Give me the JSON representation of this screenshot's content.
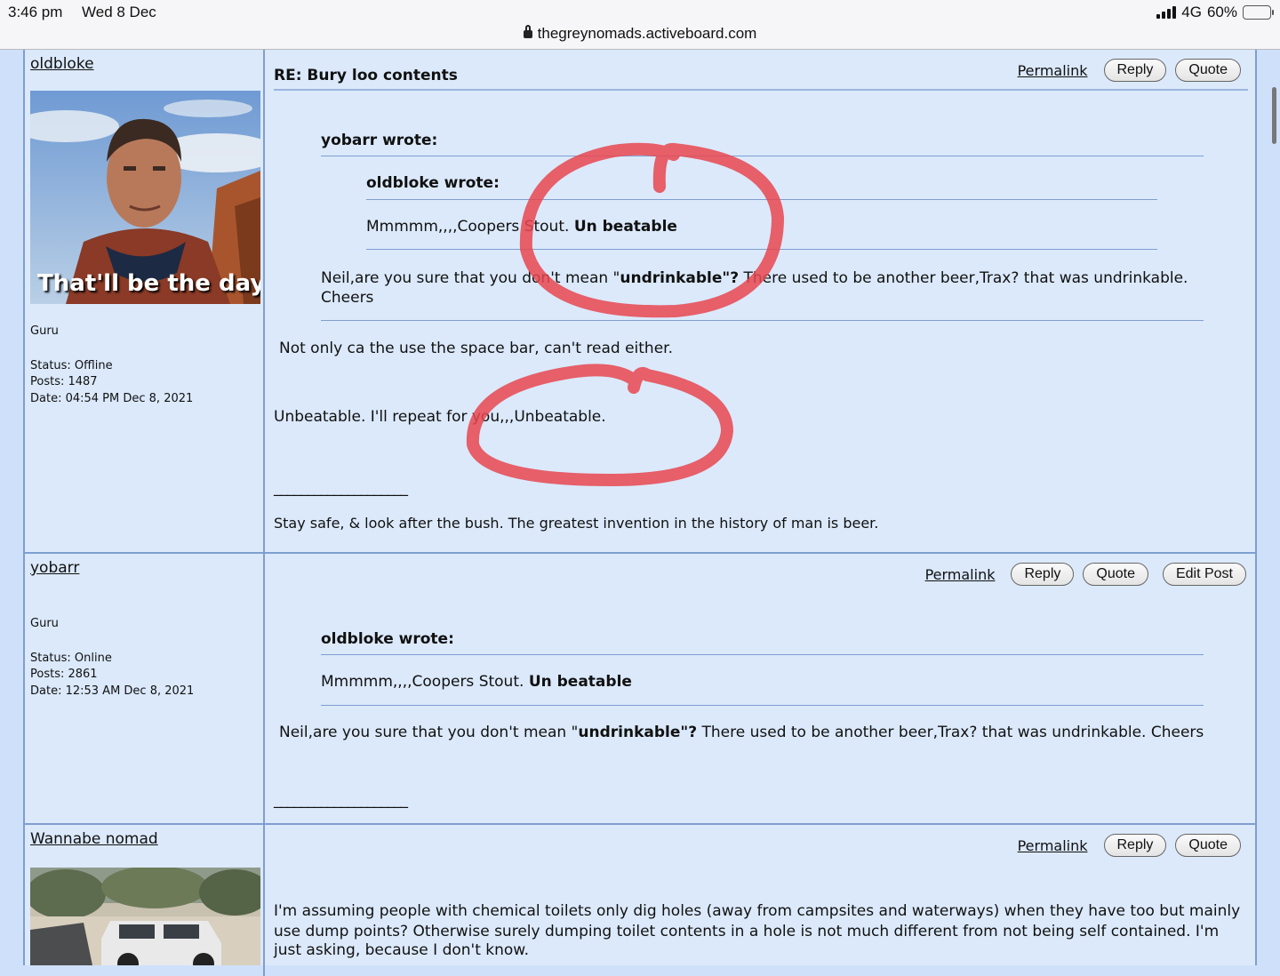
{
  "status_bar": {
    "time": "3:46 pm",
    "date": "Wed 8 Dec",
    "network": "4G",
    "battery": "60%",
    "battery_level": 0.6,
    "url": "thegreynomads.activeboard.com"
  },
  "buttons": {
    "permalink": "Permalink",
    "reply": "Reply",
    "quote": "Quote",
    "edit": "Edit Post"
  },
  "posts": [
    {
      "author": "oldbloke",
      "avatar_caption": "That'll be the day",
      "rank": "Guru",
      "status": "Status: Offline",
      "posts": "Posts: 1487",
      "date": "Date: 04:54 PM Dec 8, 2021",
      "title": "RE: Bury loo contents",
      "outer_quote_author": "yobarr wrote:",
      "inner_quote_author": "oldbloke wrote:",
      "inner_quote_text": "Mmmmm,,,,Coopers Stout. ",
      "inner_quote_bold": "Un beatable",
      "outer_quote_text_a": " Neil,are you sure that you don't  mean \"",
      "outer_quote_bold": "undrinkable\"?",
      "outer_quote_text_b": "  There used to be another beer,Trax? that was undrinkable.",
      "outer_quote_text_c": "Cheers",
      "reply_1": "Not only ca the use the space bar, can't read either.",
      "reply_2": "Unbeatable.  I'll repeat for you,,,Unbeatable.",
      "sig_line": "____________________",
      "signature": "Stay safe, & look after the bush.    The greatest invention in the history of man is beer."
    },
    {
      "author": "yobarr",
      "rank": "Guru",
      "status": "Status: Online",
      "posts": "Posts: 2861",
      "date": "Date: 12:53 AM Dec 8, 2021",
      "quote_author": "oldbloke wrote:",
      "quote_text": "Mmmmm,,,,Coopers Stout. ",
      "quote_bold": "Un beatable",
      "body_a": " Neil,are you sure that you don't  mean \"",
      "body_bold": "undrinkable\"?",
      "body_b": "  There used to be another beer,Trax? that was undrinkable. Cheers",
      "sig_line": "____________________"
    },
    {
      "author": "Wannabe nomad",
      "body_1": "I'm assuming people with chemical toilets only dig holes (away from campsites and waterways) when they have too but mainly",
      "body_2": "use dump points? Otherwise surely dumping toilet contents in a hole is not much different from not being self contained. I'm",
      "body_3": "just asking, because I don't  know."
    }
  ],
  "annotation_color": "#e8464f"
}
